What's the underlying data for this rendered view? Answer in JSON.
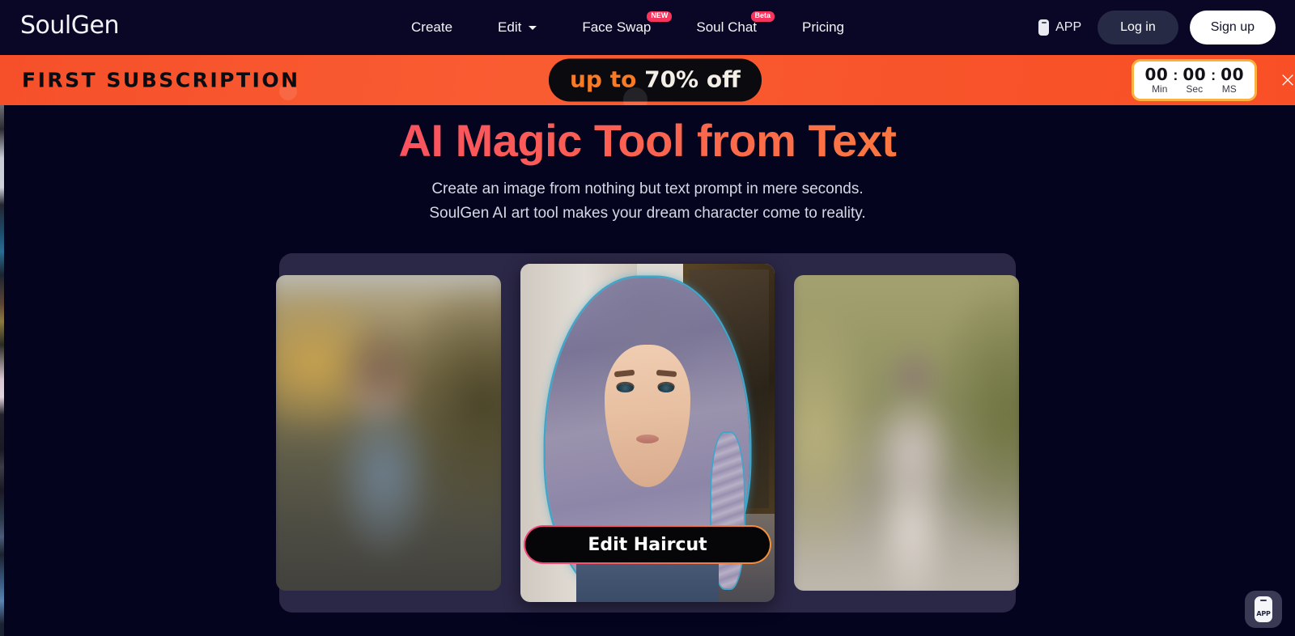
{
  "header": {
    "logo": "SoulGen",
    "nav": [
      {
        "label": "Create",
        "badge": null,
        "caret": false
      },
      {
        "label": "Edit",
        "badge": null,
        "caret": true
      },
      {
        "label": "Face Swap",
        "badge": "NEW",
        "caret": false
      },
      {
        "label": "Soul Chat",
        "badge": "Beta",
        "caret": false
      },
      {
        "label": "Pricing",
        "badge": null,
        "caret": false
      }
    ],
    "app_label": "APP",
    "app_icon": "phone-icon",
    "login_label": "Log in",
    "signup_label": "Sign up"
  },
  "promo": {
    "title": "FIRST SUBSCRIPTION",
    "pill_prefix": "up to ",
    "pill_highlight": "70% off",
    "timer": {
      "minutes": "00",
      "seconds": "00",
      "milliseconds": "00",
      "separator": ":",
      "label_min": "Min",
      "label_sec": "Sec",
      "label_ms": "MS"
    },
    "close_icon": "×",
    "accent_color": "#f8542b",
    "timer_border_color": "#fbb040"
  },
  "hero": {
    "title": "AI Magic Tool from Text",
    "subtitle_line1": "Create an image from nothing but text prompt in mere seconds.",
    "subtitle_line2": "SoulGen AI art tool makes your dream character come to reality.",
    "gradient_start": "#f63b6e",
    "gradient_end": "#fc8c33"
  },
  "carousel": {
    "background_color": "#2b2747",
    "cards": [
      {
        "position": "left",
        "state": "blurred",
        "alt": "woman outdoors autumn background"
      },
      {
        "position": "center",
        "state": "active",
        "alt": "woman with braided blue hair highlighted"
      },
      {
        "position": "right",
        "state": "blurred",
        "alt": "woman in white dress garden background"
      }
    ],
    "cta_label": "Edit Haircut"
  },
  "floating": {
    "app_label": "APP",
    "icon": "phone-app-icon"
  }
}
